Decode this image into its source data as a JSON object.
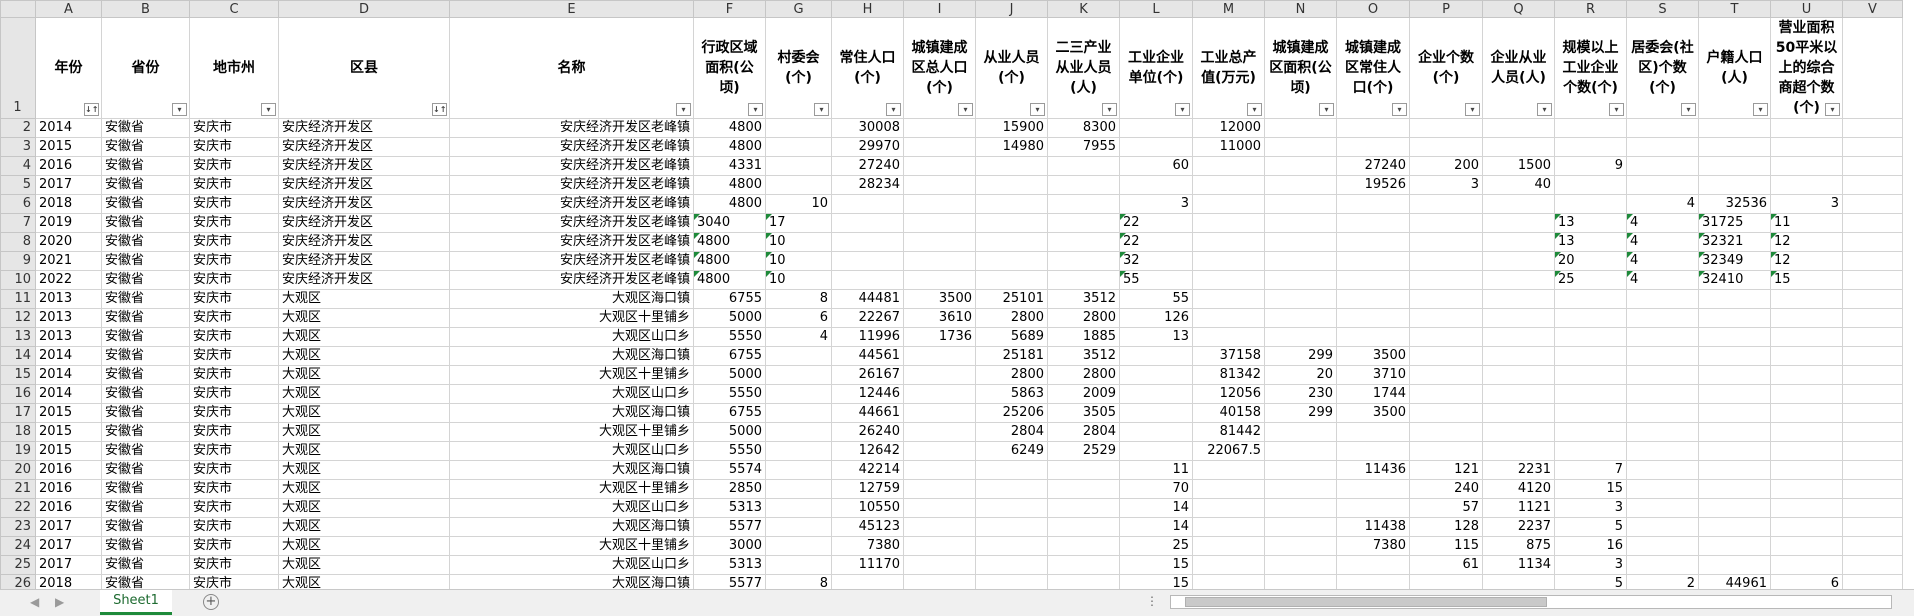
{
  "column_letters": [
    "A",
    "B",
    "C",
    "D",
    "E",
    "F",
    "G",
    "H",
    "I",
    "J",
    "K",
    "L",
    "M",
    "N",
    "O",
    "P",
    "Q",
    "R",
    "S",
    "T",
    "U",
    "V"
  ],
  "headers": [
    "年份",
    "省份",
    "地市州",
    "区县",
    "名称",
    "行政区域面积(公顷)",
    "村委会(个)",
    "常住人口(个)",
    "城镇建成区总人口(个)",
    "从业人员(个)",
    "二三产业从业人员(人)",
    "工业企业单位(个)",
    "工业总产值(万元)",
    "城镇建成区面积(公顷)",
    "城镇建成区常住人口(个)",
    "企业个数(个)",
    "企业从业人员(人)",
    "规模以上工业企业个数(个)",
    "居委会(社区)个数(个)",
    "户籍人口(人)",
    "营业面积50平米以上的综合商超个数(个)",
    ""
  ],
  "filter_glyphs": [
    "↓↑",
    "▾",
    "▾",
    "↓↑",
    "▾",
    "▾",
    "▾",
    "▾",
    "▾",
    "▾",
    "▾",
    "▾",
    "▾",
    "▾",
    "▾",
    "▾",
    "▾",
    "▾",
    "▾",
    "▾",
    "▾"
  ],
  "rows": [
    {
      "n": "2",
      "c": [
        "2014",
        "安徽省",
        "安庆市",
        "安庆经济开发区",
        "安庆经济开发区老峰镇",
        "4800",
        "",
        "30008",
        "",
        "15900",
        "8300",
        "",
        "12000",
        "",
        "",
        "",
        "",
        "",
        "",
        "",
        "",
        ""
      ]
    },
    {
      "n": "3",
      "c": [
        "2015",
        "安徽省",
        "安庆市",
        "安庆经济开发区",
        "安庆经济开发区老峰镇",
        "4800",
        "",
        "29970",
        "",
        "14980",
        "7955",
        "",
        "11000",
        "",
        "",
        "",
        "",
        "",
        "",
        "",
        "",
        ""
      ]
    },
    {
      "n": "4",
      "c": [
        "2016",
        "安徽省",
        "安庆市",
        "安庆经济开发区",
        "安庆经济开发区老峰镇",
        "4331",
        "",
        "27240",
        "",
        "",
        "",
        "60",
        "",
        "",
        "27240",
        "200",
        "1500",
        "9",
        "",
        "",
        "",
        ""
      ]
    },
    {
      "n": "5",
      "c": [
        "2017",
        "安徽省",
        "安庆市",
        "安庆经济开发区",
        "安庆经济开发区老峰镇",
        "4800",
        "",
        "28234",
        "",
        "",
        "",
        "",
        "",
        "",
        "19526",
        "3",
        "40",
        "",
        "",
        "",
        "",
        ""
      ]
    },
    {
      "n": "6",
      "c": [
        "2018",
        "安徽省",
        "安庆市",
        "安庆经济开发区",
        "安庆经济开发区老峰镇",
        "4800",
        "10",
        "",
        "",
        "",
        "",
        "3",
        "",
        "",
        "",
        "",
        "",
        "",
        "4",
        "32536",
        "3",
        ""
      ]
    },
    {
      "n": "7",
      "c": [
        "2019",
        "安徽省",
        "安庆市",
        "安庆经济开发区",
        "安庆经济开发区老峰镇",
        "3040",
        "17",
        "",
        "",
        "",
        "",
        "22",
        "",
        "",
        "",
        "",
        "",
        "13",
        "4",
        "31725",
        "11",
        ""
      ],
      "g": [
        5,
        6,
        11,
        17,
        18,
        19,
        20
      ]
    },
    {
      "n": "8",
      "c": [
        "2020",
        "安徽省",
        "安庆市",
        "安庆经济开发区",
        "安庆经济开发区老峰镇",
        "4800",
        "10",
        "",
        "",
        "",
        "",
        "22",
        "",
        "",
        "",
        "",
        "",
        "13",
        "4",
        "32321",
        "12",
        ""
      ],
      "g": [
        5,
        6,
        11,
        17,
        18,
        19,
        20
      ]
    },
    {
      "n": "9",
      "c": [
        "2021",
        "安徽省",
        "安庆市",
        "安庆经济开发区",
        "安庆经济开发区老峰镇",
        "4800",
        "10",
        "",
        "",
        "",
        "",
        "32",
        "",
        "",
        "",
        "",
        "",
        "20",
        "4",
        "32349",
        "12",
        ""
      ],
      "g": [
        5,
        6,
        11,
        17,
        18,
        19,
        20
      ]
    },
    {
      "n": "10",
      "c": [
        "2022",
        "安徽省",
        "安庆市",
        "安庆经济开发区",
        "安庆经济开发区老峰镇",
        "4800",
        "10",
        "",
        "",
        "",
        "",
        "55",
        "",
        "",
        "",
        "",
        "",
        "25",
        "4",
        "32410",
        "15",
        ""
      ],
      "g": [
        5,
        6,
        11,
        17,
        18,
        19,
        20
      ]
    },
    {
      "n": "11",
      "c": [
        "2013",
        "安徽省",
        "安庆市",
        "大观区",
        "大观区海口镇",
        "6755",
        "8",
        "44481",
        "3500",
        "25101",
        "3512",
        "55",
        "",
        "",
        "",
        "",
        "",
        "",
        "",
        "",
        "",
        ""
      ]
    },
    {
      "n": "12",
      "c": [
        "2013",
        "安徽省",
        "安庆市",
        "大观区",
        "大观区十里铺乡",
        "5000",
        "6",
        "22267",
        "3610",
        "2800",
        "2800",
        "126",
        "",
        "",
        "",
        "",
        "",
        "",
        "",
        "",
        "",
        ""
      ]
    },
    {
      "n": "13",
      "c": [
        "2013",
        "安徽省",
        "安庆市",
        "大观区",
        "大观区山口乡",
        "5550",
        "4",
        "11996",
        "1736",
        "5689",
        "1885",
        "13",
        "",
        "",
        "",
        "",
        "",
        "",
        "",
        "",
        "",
        ""
      ]
    },
    {
      "n": "14",
      "c": [
        "2014",
        "安徽省",
        "安庆市",
        "大观区",
        "大观区海口镇",
        "6755",
        "",
        "44561",
        "",
        "25181",
        "3512",
        "",
        "37158",
        "299",
        "3500",
        "",
        "",
        "",
        "",
        "",
        "",
        ""
      ]
    },
    {
      "n": "15",
      "c": [
        "2014",
        "安徽省",
        "安庆市",
        "大观区",
        "大观区十里铺乡",
        "5000",
        "",
        "26167",
        "",
        "2800",
        "2800",
        "",
        "81342",
        "20",
        "3710",
        "",
        "",
        "",
        "",
        "",
        "",
        ""
      ]
    },
    {
      "n": "16",
      "c": [
        "2014",
        "安徽省",
        "安庆市",
        "大观区",
        "大观区山口乡",
        "5550",
        "",
        "12446",
        "",
        "5863",
        "2009",
        "",
        "12056",
        "230",
        "1744",
        "",
        "",
        "",
        "",
        "",
        "",
        ""
      ]
    },
    {
      "n": "17",
      "c": [
        "2015",
        "安徽省",
        "安庆市",
        "大观区",
        "大观区海口镇",
        "6755",
        "",
        "44661",
        "",
        "25206",
        "3505",
        "",
        "40158",
        "299",
        "3500",
        "",
        "",
        "",
        "",
        "",
        "",
        ""
      ]
    },
    {
      "n": "18",
      "c": [
        "2015",
        "安徽省",
        "安庆市",
        "大观区",
        "大观区十里铺乡",
        "5000",
        "",
        "26240",
        "",
        "2804",
        "2804",
        "",
        "81442",
        "",
        "",
        "",
        "",
        "",
        "",
        "",
        "",
        ""
      ]
    },
    {
      "n": "19",
      "c": [
        "2015",
        "安徽省",
        "安庆市",
        "大观区",
        "大观区山口乡",
        "5550",
        "",
        "12642",
        "",
        "6249",
        "2529",
        "",
        "22067.5",
        "",
        "",
        "",
        "",
        "",
        "",
        "",
        "",
        ""
      ]
    },
    {
      "n": "20",
      "c": [
        "2016",
        "安徽省",
        "安庆市",
        "大观区",
        "大观区海口镇",
        "5574",
        "",
        "42214",
        "",
        "",
        "",
        "11",
        "",
        "",
        "11436",
        "121",
        "2231",
        "7",
        "",
        "",
        "",
        ""
      ]
    },
    {
      "n": "21",
      "c": [
        "2016",
        "安徽省",
        "安庆市",
        "大观区",
        "大观区十里铺乡",
        "2850",
        "",
        "12759",
        "",
        "",
        "",
        "70",
        "",
        "",
        "",
        "240",
        "4120",
        "15",
        "",
        "",
        "",
        ""
      ]
    },
    {
      "n": "22",
      "c": [
        "2016",
        "安徽省",
        "安庆市",
        "大观区",
        "大观区山口乡",
        "5313",
        "",
        "10550",
        "",
        "",
        "",
        "14",
        "",
        "",
        "",
        "57",
        "1121",
        "3",
        "",
        "",
        "",
        ""
      ]
    },
    {
      "n": "23",
      "c": [
        "2017",
        "安徽省",
        "安庆市",
        "大观区",
        "大观区海口镇",
        "5577",
        "",
        "45123",
        "",
        "",
        "",
        "14",
        "",
        "",
        "11438",
        "128",
        "2237",
        "5",
        "",
        "",
        "",
        ""
      ]
    },
    {
      "n": "24",
      "c": [
        "2017",
        "安徽省",
        "安庆市",
        "大观区",
        "大观区十里铺乡",
        "3000",
        "",
        "7380",
        "",
        "",
        "",
        "25",
        "",
        "",
        "7380",
        "115",
        "875",
        "16",
        "",
        "",
        "",
        ""
      ]
    },
    {
      "n": "25",
      "c": [
        "2017",
        "安徽省",
        "安庆市",
        "大观区",
        "大观区山口乡",
        "5313",
        "",
        "11170",
        "",
        "",
        "",
        "15",
        "",
        "",
        "",
        "61",
        "1134",
        "3",
        "",
        "",
        "",
        ""
      ]
    },
    {
      "n": "26",
      "c": [
        "2018",
        "安徽省",
        "安庆市",
        "大观区",
        "大观区海口镇",
        "5577",
        "8",
        "",
        "",
        "",
        "",
        "15",
        "",
        "",
        "",
        "",
        "",
        "5",
        "2",
        "44961",
        "6",
        ""
      ]
    }
  ],
  "sheet_tab": "Sheet1",
  "add_sheet_glyph": "+",
  "nav_prev": "◀",
  "nav_next": "▶",
  "scroll_dots": "⋮",
  "accent_color": "#1e8a3a"
}
